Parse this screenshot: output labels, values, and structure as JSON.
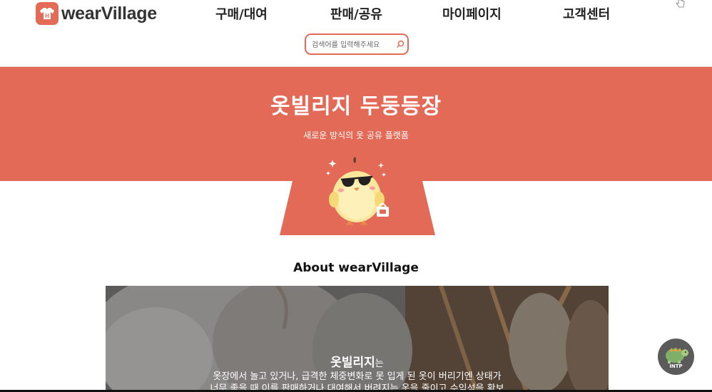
{
  "header": {
    "logo_text": "wearVillage",
    "nav": [
      {
        "label": "구매/대여"
      },
      {
        "label": "판매/공유"
      },
      {
        "label": "마이페이지"
      },
      {
        "label": "고객센터"
      }
    ],
    "search": {
      "placeholder": "검색어를 입력해주세요",
      "value": ""
    }
  },
  "banner": {
    "title": "옷빌리지 두둥등장",
    "subtitle": "새로운 방식의 옷 공유 플랫폼"
  },
  "about": {
    "title": "About wearVillage",
    "photo_heading": "옷빌리지",
    "photo_heading_suffix": "는",
    "lines": [
      "옷장에서 놀고 있거나, 급격한 체중변화로 못 입게 된 옷이 버리기엔 상태가",
      "너무 좋을 때 이를 판매하거나 대여해서 버려지는 옷을 줄이고 수익성을 확보"
    ]
  },
  "badge": {
    "label": "INTP"
  },
  "colors": {
    "brand": "#e26a56",
    "text": "#222222"
  },
  "icons": [
    "logo-shirt-icon",
    "search-icon",
    "hand-cursor-icon",
    "chick-mascot",
    "intp-avatar"
  ]
}
